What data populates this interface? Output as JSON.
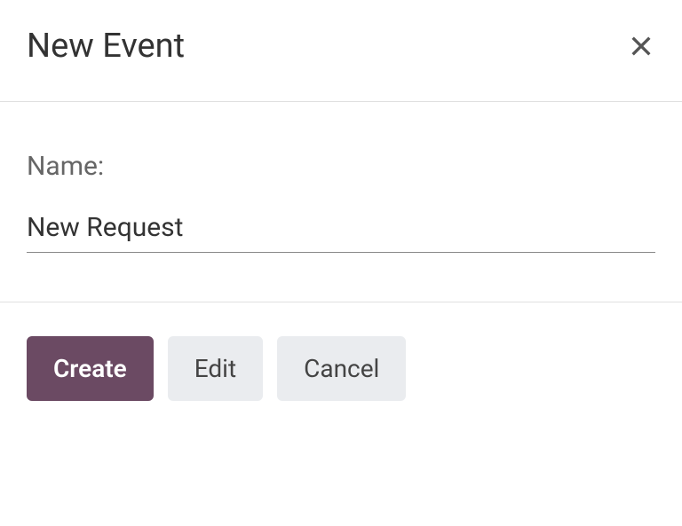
{
  "dialog": {
    "title": "New Event"
  },
  "form": {
    "name_label": "Name:",
    "name_value": "New Request"
  },
  "actions": {
    "create_label": "Create",
    "edit_label": "Edit",
    "cancel_label": "Cancel"
  },
  "colors": {
    "primary": "#6b4a63",
    "secondary_bg": "#eaecef"
  }
}
